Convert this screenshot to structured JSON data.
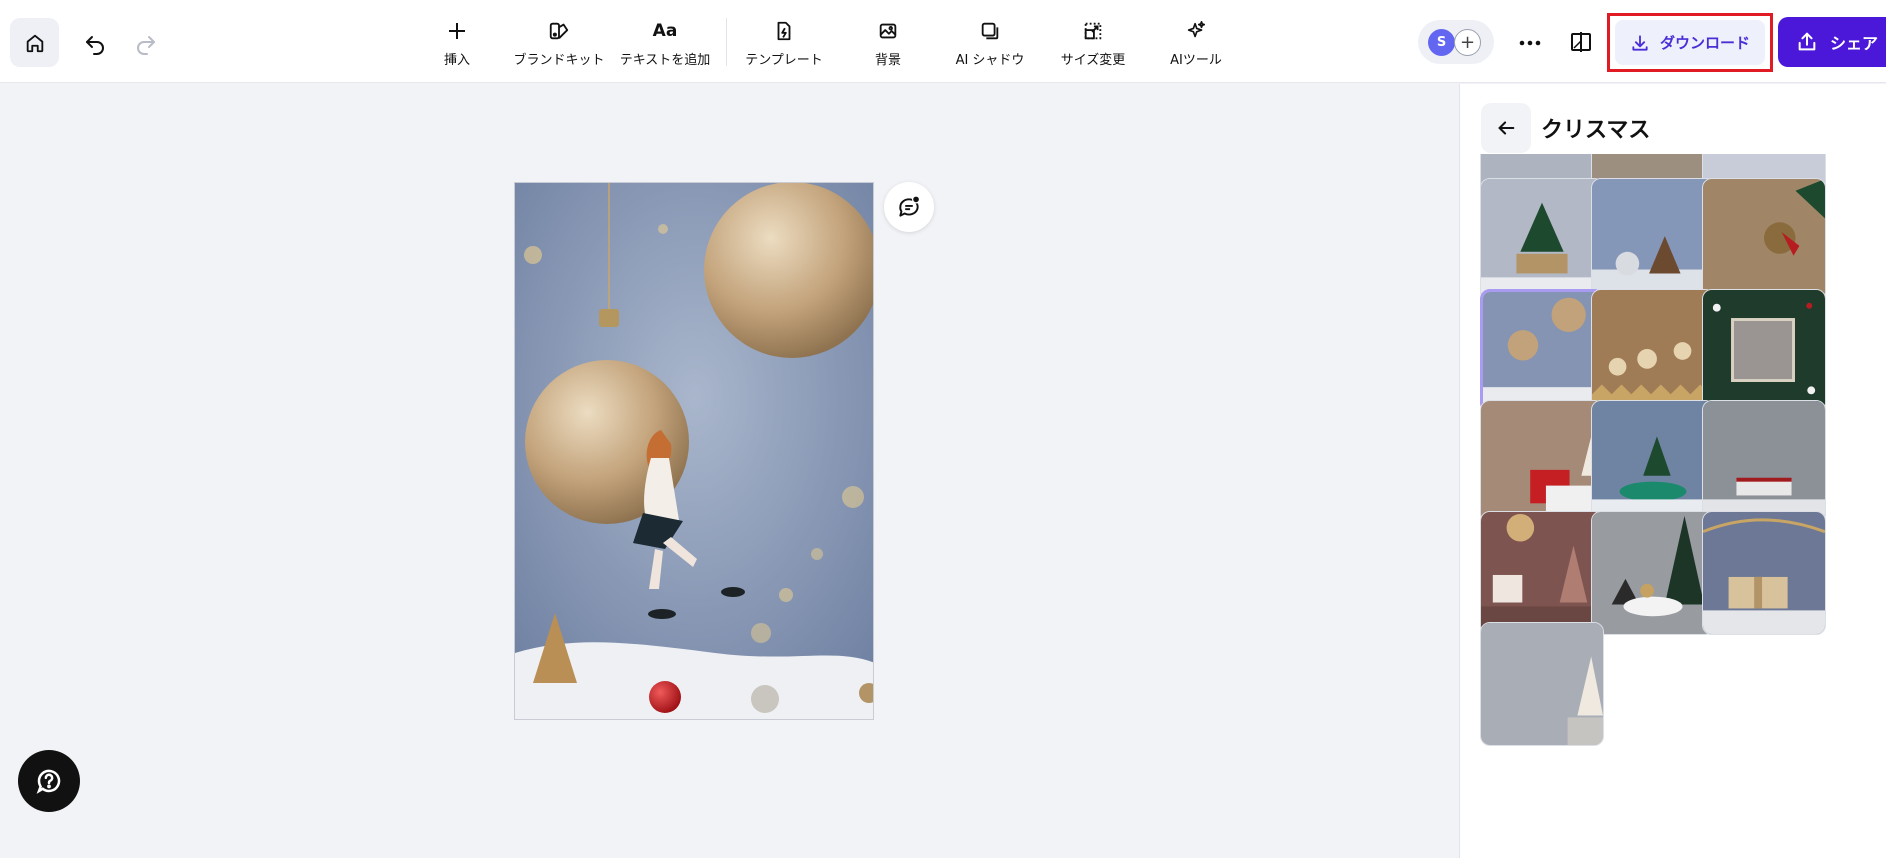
{
  "toolbar": {
    "insert": "挿入",
    "brand_kit": "ブランドキット",
    "add_text": "テキストを追加",
    "add_text_icon": "Aa",
    "template": "テンプレート",
    "background": "背景",
    "ai_shadow": "AI シャドウ",
    "resize": "サイズ変更",
    "ai_tools": "AIツール"
  },
  "collaborators": {
    "avatar_initial": "S"
  },
  "actions": {
    "download_label": "ダウンロード",
    "share_label": "シェア"
  },
  "panel": {
    "title": "クリスマス"
  },
  "colors": {
    "accent": "#4b18d9",
    "download_text": "#4b2fd6",
    "highlight": "#e01b24",
    "selected_border": "#a99af2"
  },
  "icons": [
    "home-icon",
    "undo-icon",
    "redo-icon",
    "plus-icon",
    "brand-kit-icon",
    "template-icon",
    "background-icon",
    "ai-shadow-icon",
    "resize-icon",
    "sparkle-icon",
    "more-icon",
    "compare-icon",
    "download-icon",
    "share-icon",
    "back-arrow-icon",
    "comment-icon",
    "help-icon"
  ]
}
